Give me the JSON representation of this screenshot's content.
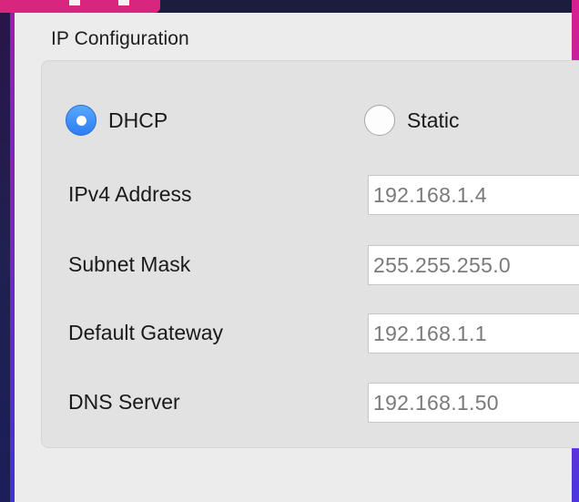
{
  "window": {
    "section_title": "IP Configuration"
  },
  "ip_config": {
    "mode_options": [
      {
        "label": "DHCP",
        "selected": true
      },
      {
        "label": "Static",
        "selected": false
      }
    ],
    "fields": [
      {
        "label": "IPv4 Address",
        "value": "192.168.1.4"
      },
      {
        "label": "Subnet Mask",
        "value": "255.255.255.0"
      },
      {
        "label": "Default Gateway",
        "value": "192.168.1.1"
      },
      {
        "label": "DNS Server",
        "value": "192.168.1.50"
      }
    ]
  },
  "colors": {
    "accent_blue": "#2b7ef4",
    "frame_magenta": "#d8257e",
    "panel_bg": "#ececec",
    "group_bg": "#e2e2e2"
  },
  "icons": {
    "selected_radio": "radio-selected-icon",
    "unselected_radio": "radio-unselected-icon"
  }
}
